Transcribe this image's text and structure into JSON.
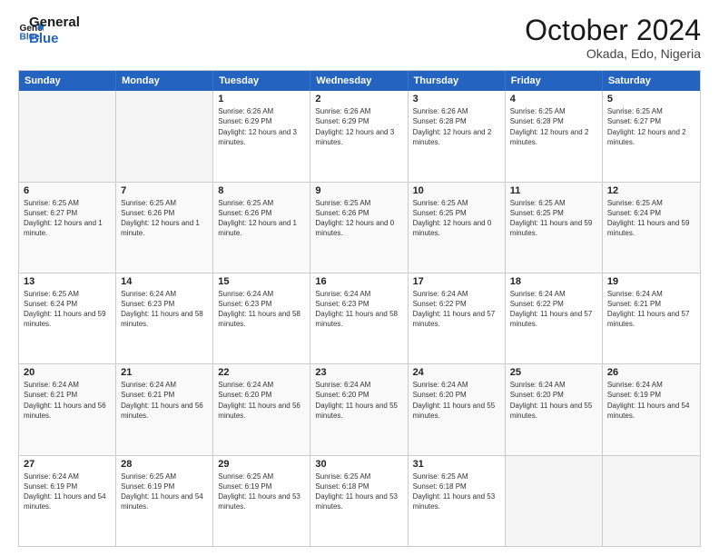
{
  "header": {
    "logo_line1": "General",
    "logo_line2": "Blue",
    "month": "October 2024",
    "location": "Okada, Edo, Nigeria"
  },
  "weekdays": [
    "Sunday",
    "Monday",
    "Tuesday",
    "Wednesday",
    "Thursday",
    "Friday",
    "Saturday"
  ],
  "rows": [
    [
      {
        "day": "",
        "info": ""
      },
      {
        "day": "",
        "info": ""
      },
      {
        "day": "1",
        "info": "Sunrise: 6:26 AM\nSunset: 6:29 PM\nDaylight: 12 hours and 3 minutes."
      },
      {
        "day": "2",
        "info": "Sunrise: 6:26 AM\nSunset: 6:29 PM\nDaylight: 12 hours and 3 minutes."
      },
      {
        "day": "3",
        "info": "Sunrise: 6:26 AM\nSunset: 6:28 PM\nDaylight: 12 hours and 2 minutes."
      },
      {
        "day": "4",
        "info": "Sunrise: 6:25 AM\nSunset: 6:28 PM\nDaylight: 12 hours and 2 minutes."
      },
      {
        "day": "5",
        "info": "Sunrise: 6:25 AM\nSunset: 6:27 PM\nDaylight: 12 hours and 2 minutes."
      }
    ],
    [
      {
        "day": "6",
        "info": "Sunrise: 6:25 AM\nSunset: 6:27 PM\nDaylight: 12 hours and 1 minute."
      },
      {
        "day": "7",
        "info": "Sunrise: 6:25 AM\nSunset: 6:26 PM\nDaylight: 12 hours and 1 minute."
      },
      {
        "day": "8",
        "info": "Sunrise: 6:25 AM\nSunset: 6:26 PM\nDaylight: 12 hours and 1 minute."
      },
      {
        "day": "9",
        "info": "Sunrise: 6:25 AM\nSunset: 6:26 PM\nDaylight: 12 hours and 0 minutes."
      },
      {
        "day": "10",
        "info": "Sunrise: 6:25 AM\nSunset: 6:25 PM\nDaylight: 12 hours and 0 minutes."
      },
      {
        "day": "11",
        "info": "Sunrise: 6:25 AM\nSunset: 6:25 PM\nDaylight: 11 hours and 59 minutes."
      },
      {
        "day": "12",
        "info": "Sunrise: 6:25 AM\nSunset: 6:24 PM\nDaylight: 11 hours and 59 minutes."
      }
    ],
    [
      {
        "day": "13",
        "info": "Sunrise: 6:25 AM\nSunset: 6:24 PM\nDaylight: 11 hours and 59 minutes."
      },
      {
        "day": "14",
        "info": "Sunrise: 6:24 AM\nSunset: 6:23 PM\nDaylight: 11 hours and 58 minutes."
      },
      {
        "day": "15",
        "info": "Sunrise: 6:24 AM\nSunset: 6:23 PM\nDaylight: 11 hours and 58 minutes."
      },
      {
        "day": "16",
        "info": "Sunrise: 6:24 AM\nSunset: 6:23 PM\nDaylight: 11 hours and 58 minutes."
      },
      {
        "day": "17",
        "info": "Sunrise: 6:24 AM\nSunset: 6:22 PM\nDaylight: 11 hours and 57 minutes."
      },
      {
        "day": "18",
        "info": "Sunrise: 6:24 AM\nSunset: 6:22 PM\nDaylight: 11 hours and 57 minutes."
      },
      {
        "day": "19",
        "info": "Sunrise: 6:24 AM\nSunset: 6:21 PM\nDaylight: 11 hours and 57 minutes."
      }
    ],
    [
      {
        "day": "20",
        "info": "Sunrise: 6:24 AM\nSunset: 6:21 PM\nDaylight: 11 hours and 56 minutes."
      },
      {
        "day": "21",
        "info": "Sunrise: 6:24 AM\nSunset: 6:21 PM\nDaylight: 11 hours and 56 minutes."
      },
      {
        "day": "22",
        "info": "Sunrise: 6:24 AM\nSunset: 6:20 PM\nDaylight: 11 hours and 56 minutes."
      },
      {
        "day": "23",
        "info": "Sunrise: 6:24 AM\nSunset: 6:20 PM\nDaylight: 11 hours and 55 minutes."
      },
      {
        "day": "24",
        "info": "Sunrise: 6:24 AM\nSunset: 6:20 PM\nDaylight: 11 hours and 55 minutes."
      },
      {
        "day": "25",
        "info": "Sunrise: 6:24 AM\nSunset: 6:20 PM\nDaylight: 11 hours and 55 minutes."
      },
      {
        "day": "26",
        "info": "Sunrise: 6:24 AM\nSunset: 6:19 PM\nDaylight: 11 hours and 54 minutes."
      }
    ],
    [
      {
        "day": "27",
        "info": "Sunrise: 6:24 AM\nSunset: 6:19 PM\nDaylight: 11 hours and 54 minutes."
      },
      {
        "day": "28",
        "info": "Sunrise: 6:25 AM\nSunset: 6:19 PM\nDaylight: 11 hours and 54 minutes."
      },
      {
        "day": "29",
        "info": "Sunrise: 6:25 AM\nSunset: 6:19 PM\nDaylight: 11 hours and 53 minutes."
      },
      {
        "day": "30",
        "info": "Sunrise: 6:25 AM\nSunset: 6:18 PM\nDaylight: 11 hours and 53 minutes."
      },
      {
        "day": "31",
        "info": "Sunrise: 6:25 AM\nSunset: 6:18 PM\nDaylight: 11 hours and 53 minutes."
      },
      {
        "day": "",
        "info": ""
      },
      {
        "day": "",
        "info": ""
      }
    ]
  ],
  "colors": {
    "header_bg": "#2563c0",
    "header_text": "#ffffff",
    "border": "#cccccc",
    "alt_row": "#f9f9f9"
  }
}
